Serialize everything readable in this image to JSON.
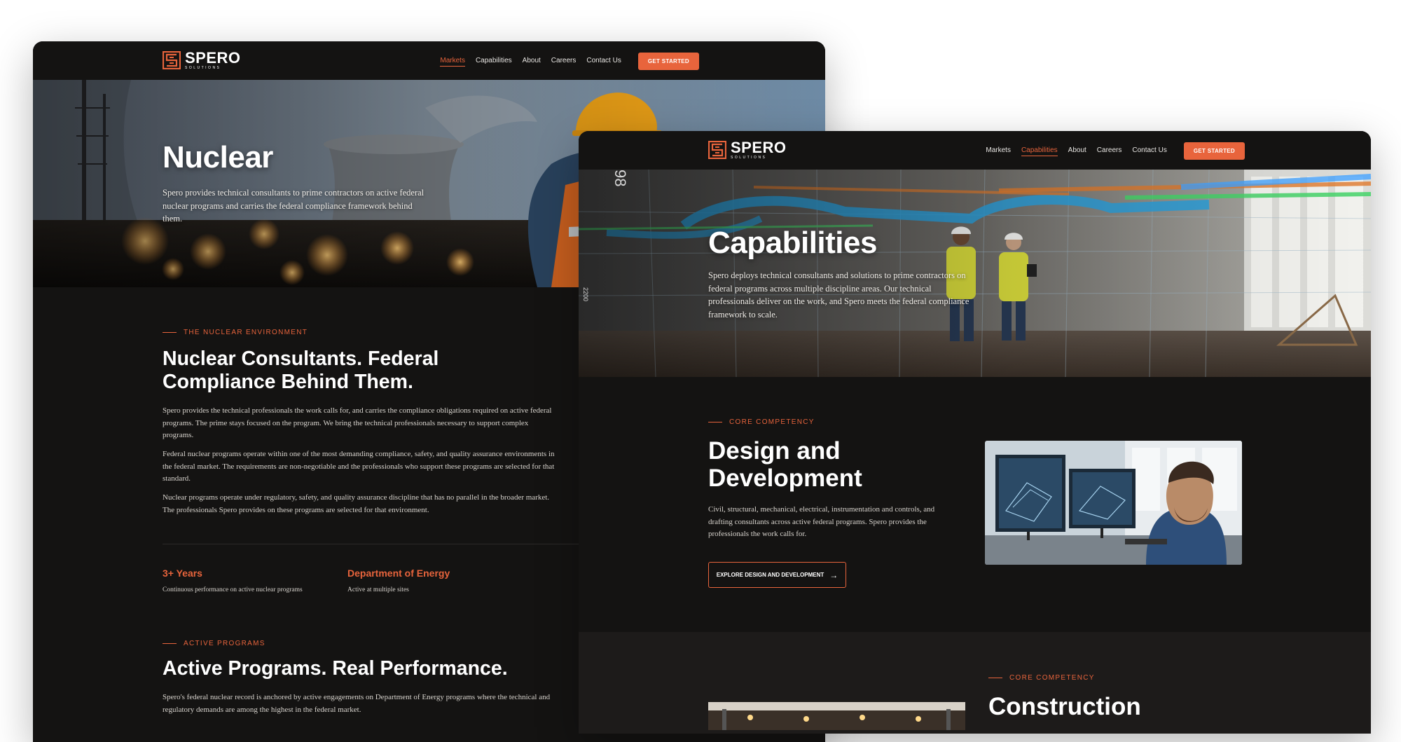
{
  "brand": {
    "name": "SPERO",
    "tagline": "SOLUTIONS"
  },
  "colors": {
    "accent": "#e8643c",
    "background": "#141312",
    "section_alt": "#1d1b1a"
  },
  "nav": {
    "items": [
      "Markets",
      "Capabilities",
      "About",
      "Careers",
      "Contact Us"
    ],
    "cta": "GET STARTED"
  },
  "nuclear_page": {
    "active_nav": "Markets",
    "hero": {
      "title": "Nuclear",
      "text": "Spero provides technical consultants to prime contractors on active federal nuclear programs and carries the federal compliance framework behind them."
    },
    "environment": {
      "eyebrow": "THE NUCLEAR ENVIRONMENT",
      "heading_line1": "Nuclear Consultants. Federal",
      "heading_line2": "Compliance Behind Them.",
      "paragraphs": [
        "Spero provides the technical professionals the work calls for, and carries the compliance obligations required on active federal programs. The prime stays focused on the program. We bring the technical professionals necessary to support complex programs.",
        "Federal nuclear programs operate within one of the most demanding compliance, safety, and quality assurance environments in the federal market. The requirements are non-negotiable and the professionals who support these programs are selected for that standard.",
        "Nuclear programs operate under regulatory, safety, and quality assurance discipline that has no parallel in the broader market. The professionals Spero provides on these programs are selected for that environment."
      ]
    },
    "stats": [
      {
        "title": "3+ Years",
        "subtitle": "Continuous performance on active nuclear programs"
      },
      {
        "title": "Department of Energy",
        "subtitle": "Active at multiple sites"
      }
    ],
    "programs": {
      "eyebrow": "ACTIVE PROGRAMS",
      "heading": "Active Programs. Real Performance.",
      "text": "Spero's federal nuclear record is anchored by active engagements on Department of Energy programs where the technical and regulatory demands are among the highest in the federal market."
    }
  },
  "capabilities_page": {
    "active_nav": "Capabilities",
    "hero": {
      "title": "Capabilities",
      "text": "Spero deploys technical consultants and solutions to prime contractors on federal programs across multiple discipline areas. Our technical professionals deliver on the work, and Spero meets the federal compliance framework to scale.",
      "overlay_text_1": "98",
      "overlay_text_2": "2200"
    },
    "design": {
      "eyebrow": "CORE COMPETENCY",
      "heading_line1": "Design and",
      "heading_line2": "Development",
      "text": "Civil, structural, mechanical, electrical, instrumentation and controls, and drafting consultants across active federal programs. Spero provides the professionals the work calls for.",
      "button": "EXPLORE DESIGN AND DEVELOPMENT"
    },
    "construction": {
      "eyebrow": "CORE COMPETENCY",
      "heading": "Construction"
    }
  }
}
